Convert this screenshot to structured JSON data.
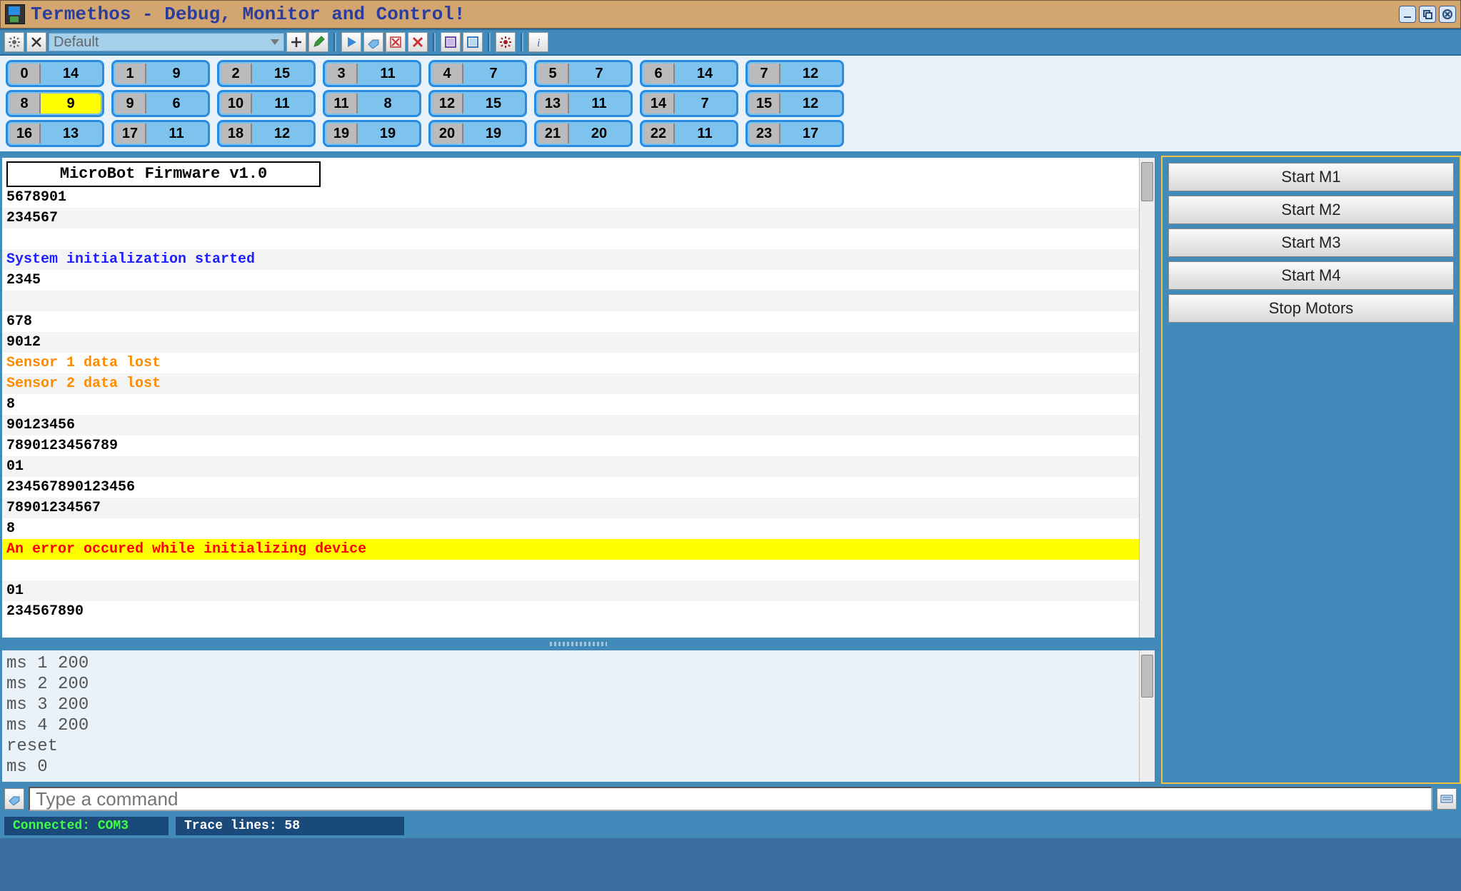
{
  "window": {
    "title": "Termethos - Debug, Monitor and Control!"
  },
  "toolbar": {
    "profile_selected": "Default"
  },
  "channels": [
    [
      {
        "idx": "0",
        "val": "14"
      },
      {
        "idx": "1",
        "val": "9"
      },
      {
        "idx": "2",
        "val": "15"
      },
      {
        "idx": "3",
        "val": "11"
      },
      {
        "idx": "4",
        "val": "7"
      },
      {
        "idx": "5",
        "val": "7"
      },
      {
        "idx": "6",
        "val": "14"
      },
      {
        "idx": "7",
        "val": "12"
      }
    ],
    [
      {
        "idx": "8",
        "val": "9",
        "hi": true
      },
      {
        "idx": "9",
        "val": "6"
      },
      {
        "idx": "10",
        "val": "11"
      },
      {
        "idx": "11",
        "val": "8"
      },
      {
        "idx": "12",
        "val": "15"
      },
      {
        "idx": "13",
        "val": "11"
      },
      {
        "idx": "14",
        "val": "7"
      },
      {
        "idx": "15",
        "val": "12"
      }
    ],
    [
      {
        "idx": "16",
        "val": "13"
      },
      {
        "idx": "17",
        "val": "11"
      },
      {
        "idx": "18",
        "val": "12"
      },
      {
        "idx": "19",
        "val": "19"
      },
      {
        "idx": "20",
        "val": "19"
      },
      {
        "idx": "21",
        "val": "20"
      },
      {
        "idx": "22",
        "val": "11"
      },
      {
        "idx": "23",
        "val": "17"
      }
    ]
  ],
  "trace": {
    "title": "MicroBot Firmware v1.0",
    "lines": [
      {
        "t": "5678901",
        "c": ""
      },
      {
        "t": "234567",
        "c": "alt"
      },
      {
        "t": " ",
        "c": ""
      },
      {
        "t": "System initialization started",
        "c": "alt info"
      },
      {
        "t": "2345",
        "c": ""
      },
      {
        "t": " ",
        "c": "alt"
      },
      {
        "t": "678",
        "c": ""
      },
      {
        "t": "9012",
        "c": "alt"
      },
      {
        "t": "Sensor 1 data lost",
        "c": "warn"
      },
      {
        "t": "Sensor 2 data lost",
        "c": "alt warn"
      },
      {
        "t": "8",
        "c": ""
      },
      {
        "t": "90123456",
        "c": "alt"
      },
      {
        "t": "7890123456789",
        "c": ""
      },
      {
        "t": "01",
        "c": "alt"
      },
      {
        "t": "234567890123456",
        "c": ""
      },
      {
        "t": "78901234567",
        "c": "alt"
      },
      {
        "t": "8",
        "c": ""
      },
      {
        "t": "An error occured while initializing device",
        "c": "err"
      },
      {
        "t": " ",
        "c": ""
      },
      {
        "t": "01",
        "c": "alt"
      },
      {
        "t": "234567890",
        "c": ""
      }
    ]
  },
  "history": [
    "ms 1 200",
    "ms 2 200",
    "ms 3 200",
    "ms 4 200",
    "reset",
    "ms 0"
  ],
  "macros": [
    "Start M1",
    "Start M2",
    "Start M3",
    "Start M4",
    "Stop Motors"
  ],
  "cmd": {
    "placeholder": "Type a command"
  },
  "status": {
    "connection": "Connected: COM3",
    "trace_lines": "Trace lines: 58"
  }
}
